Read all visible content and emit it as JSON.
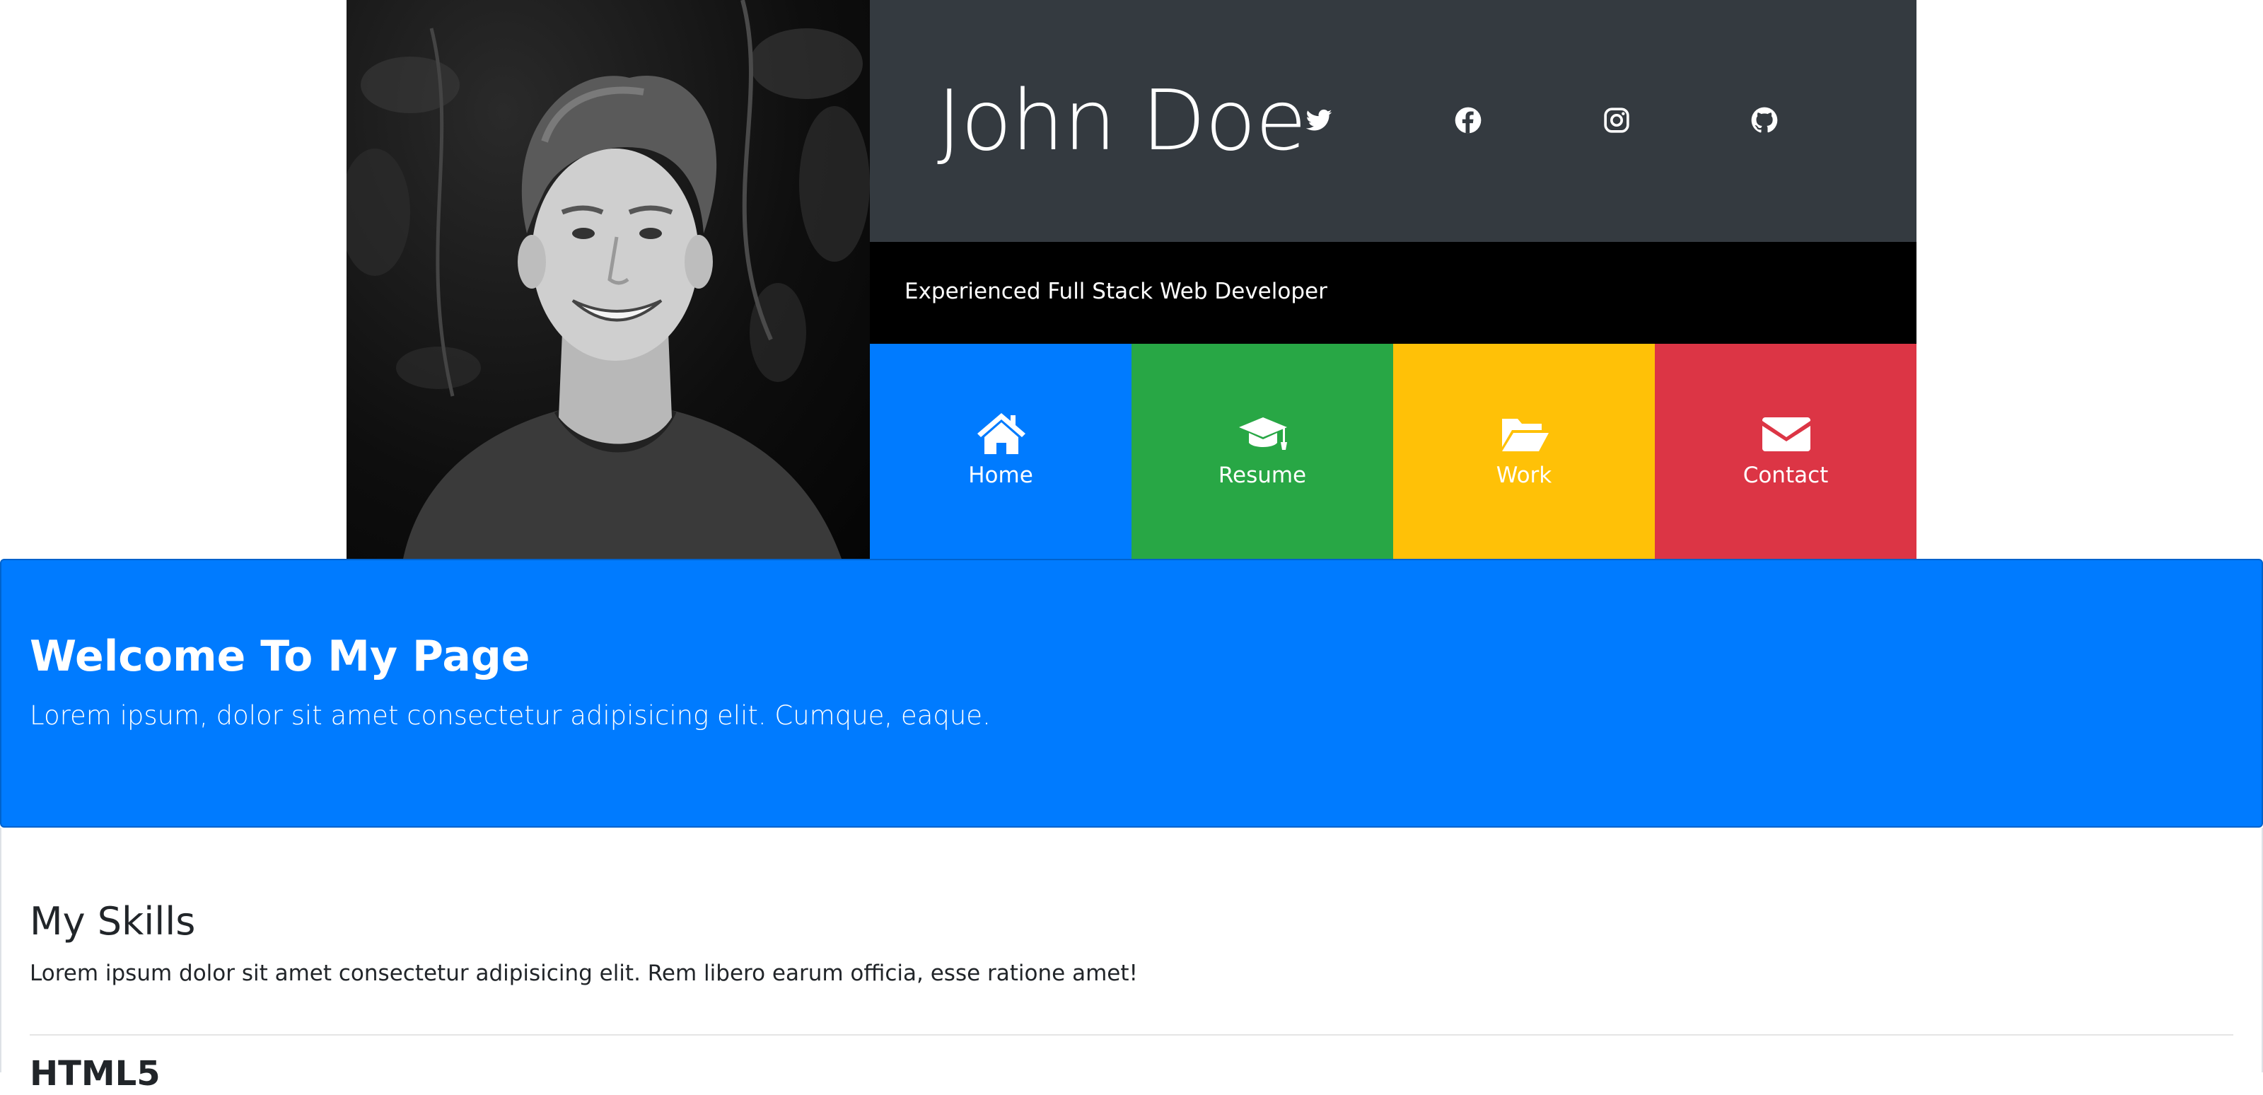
{
  "header": {
    "name": "John Doe",
    "tagline": "Experienced Full Stack Web Developer",
    "social": [
      {
        "icon": "twitter-icon"
      },
      {
        "icon": "facebook-icon"
      },
      {
        "icon": "instagram-icon"
      },
      {
        "icon": "github-icon"
      }
    ],
    "colors": {
      "name_bar": "#343a40",
      "tagline_bar": "#000000"
    }
  },
  "nav": {
    "tiles": [
      {
        "label": "Home",
        "icon": "home-icon",
        "color": "#007bff"
      },
      {
        "label": "Resume",
        "icon": "graduation-cap-icon",
        "color": "#28a745"
      },
      {
        "label": "Work",
        "icon": "folder-open-icon",
        "color": "#ffc107"
      },
      {
        "label": "Contact",
        "icon": "envelope-icon",
        "color": "#dc3545"
      }
    ]
  },
  "jumbotron": {
    "title": "Welcome To My Page",
    "text": "Lorem ipsum, dolor sit amet consectetur adipisicing elit. Cumque, eaque.",
    "color": "#007bff"
  },
  "skills": {
    "title": "My Skills",
    "text": "Lorem ipsum dolor sit amet consectetur adipisicing elit. Rem libero earum officia, esse ratione amet!",
    "items": [
      {
        "name": "HTML5"
      }
    ]
  }
}
